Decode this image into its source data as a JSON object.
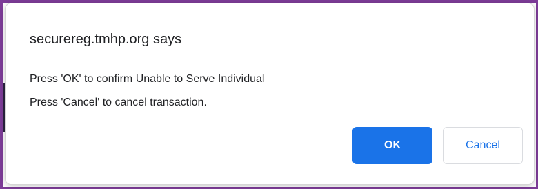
{
  "dialog": {
    "title": "securereg.tmhp.org says",
    "message_lines": [
      "Press 'OK' to confirm Unable to Serve Individual",
      "Press 'Cancel' to cancel transaction."
    ],
    "ok_label": "OK",
    "cancel_label": "Cancel"
  },
  "colors": {
    "accent": "#1a73e8",
    "frame": "#7d3c98",
    "text": "#202124"
  }
}
